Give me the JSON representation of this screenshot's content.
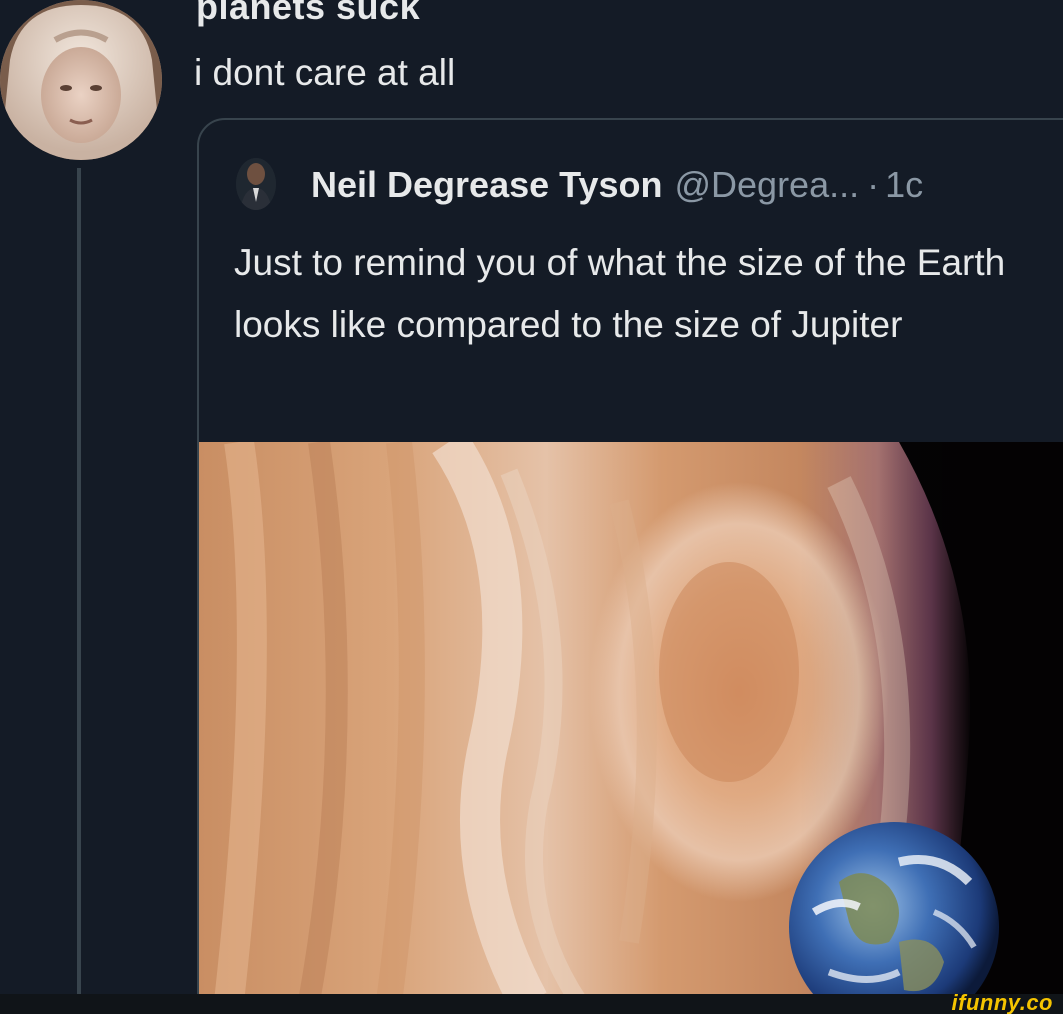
{
  "reply": {
    "display_name": "planets suck",
    "text": "i dont care at all"
  },
  "quoted_tweet": {
    "display_name": "Neil Degrease Tyson",
    "handle": "@Degrea...",
    "separator": "·",
    "time": "1c",
    "text": "Just to remind you of what the size of the Earth looks like compared to the size of Jupiter"
  },
  "image": {
    "subject": "jupiter-and-earth"
  },
  "watermark": {
    "text": "ifunny.co",
    "color": "#f5c400"
  },
  "colors": {
    "background": "#141b26",
    "text_primary": "#e7e9ea",
    "text_secondary": "#8b98a5",
    "border": "#38444d"
  }
}
